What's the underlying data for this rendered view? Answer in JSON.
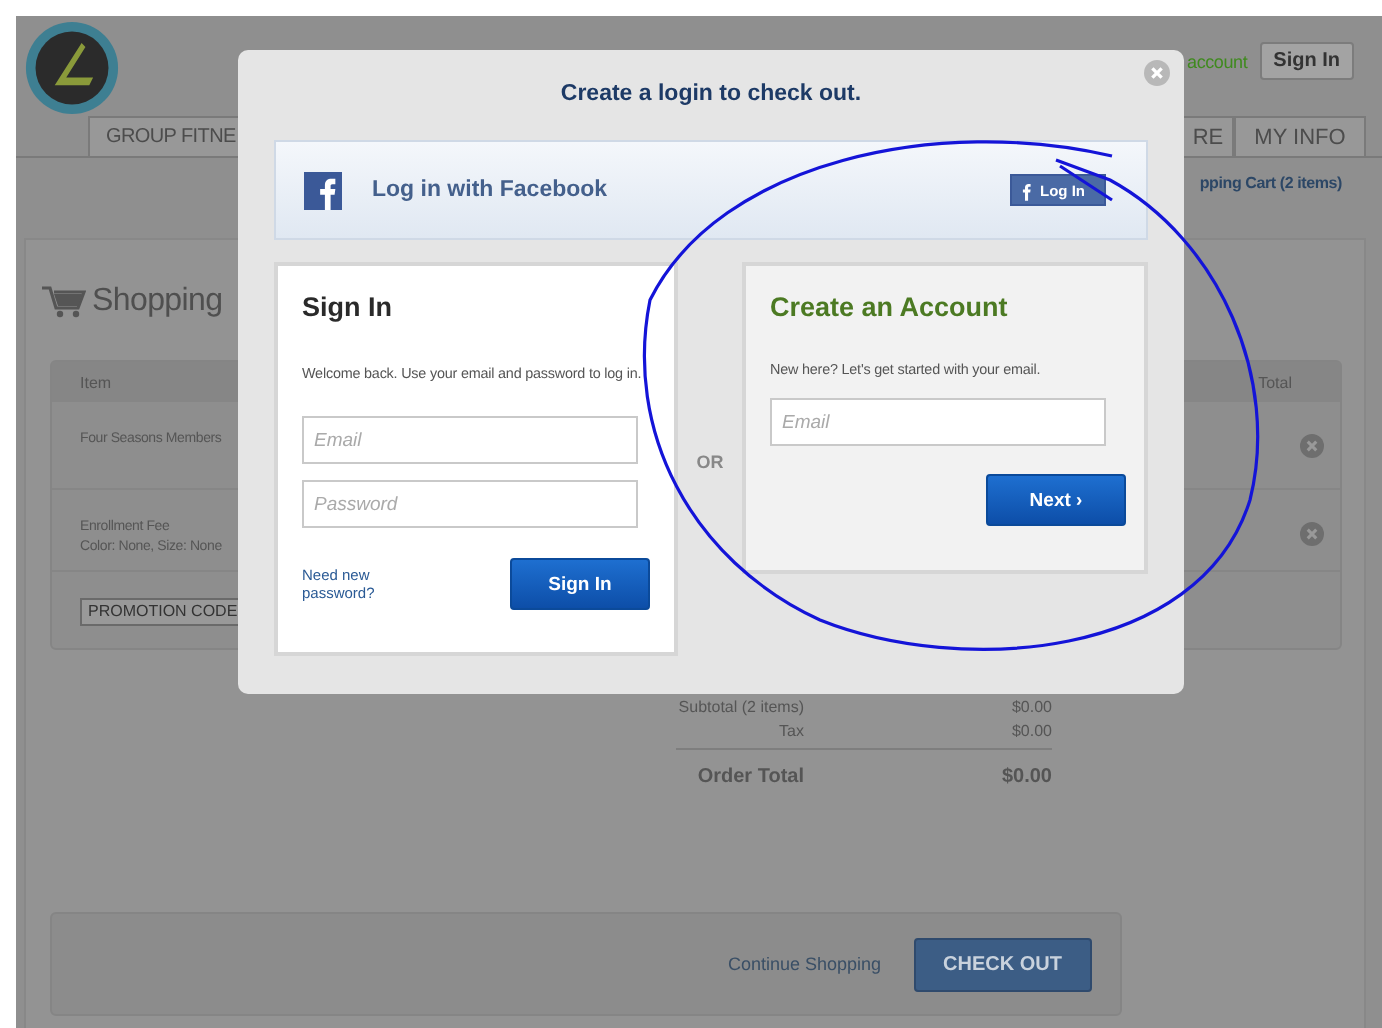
{
  "header": {
    "account_link": "account",
    "sign_in_button": "Sign In"
  },
  "nav_tabs": [
    {
      "label": "GROUP FITNE",
      "selected": false
    },
    {
      "label": "RE",
      "selected": false
    },
    {
      "label": "MY INFO",
      "selected": false
    }
  ],
  "cart_link": "pping Cart (2 items)",
  "page_title": "Shopping",
  "cart_table": {
    "columns": [
      "Item",
      "Total"
    ],
    "rows": [
      {
        "lines": [
          "Four Seasons Members"
        ]
      },
      {
        "lines": [
          "Enrollment Fee",
          "Color: None, Size: None"
        ]
      }
    ],
    "promo_placeholder": "PROMOTION CODE"
  },
  "summary": [
    {
      "label": "Subtotal (2 items)",
      "value": "$0.00",
      "kind": "line"
    },
    {
      "label": "Tax",
      "value": "$0.00",
      "kind": "line"
    },
    {
      "label": "Order Total",
      "value": "$0.00",
      "kind": "total"
    }
  ],
  "footer": {
    "continue_link": "Continue Shopping",
    "checkout_button": "CHECK OUT"
  },
  "modal": {
    "title": "Create a login to check out.",
    "facebook": {
      "label": "Log in with Facebook",
      "button": "Log In"
    },
    "sign_in": {
      "title": "Sign In",
      "text": "Welcome back. Use your email and password to log in.",
      "email_placeholder": "Email",
      "password_placeholder": "Password",
      "forgot_link": "Need new password?",
      "button": "Sign In"
    },
    "separator": "OR",
    "create_account": {
      "title": "Create an Account",
      "text": "New here? Let's get started with your email.",
      "email_placeholder": "Email",
      "button": "Next ›"
    }
  }
}
